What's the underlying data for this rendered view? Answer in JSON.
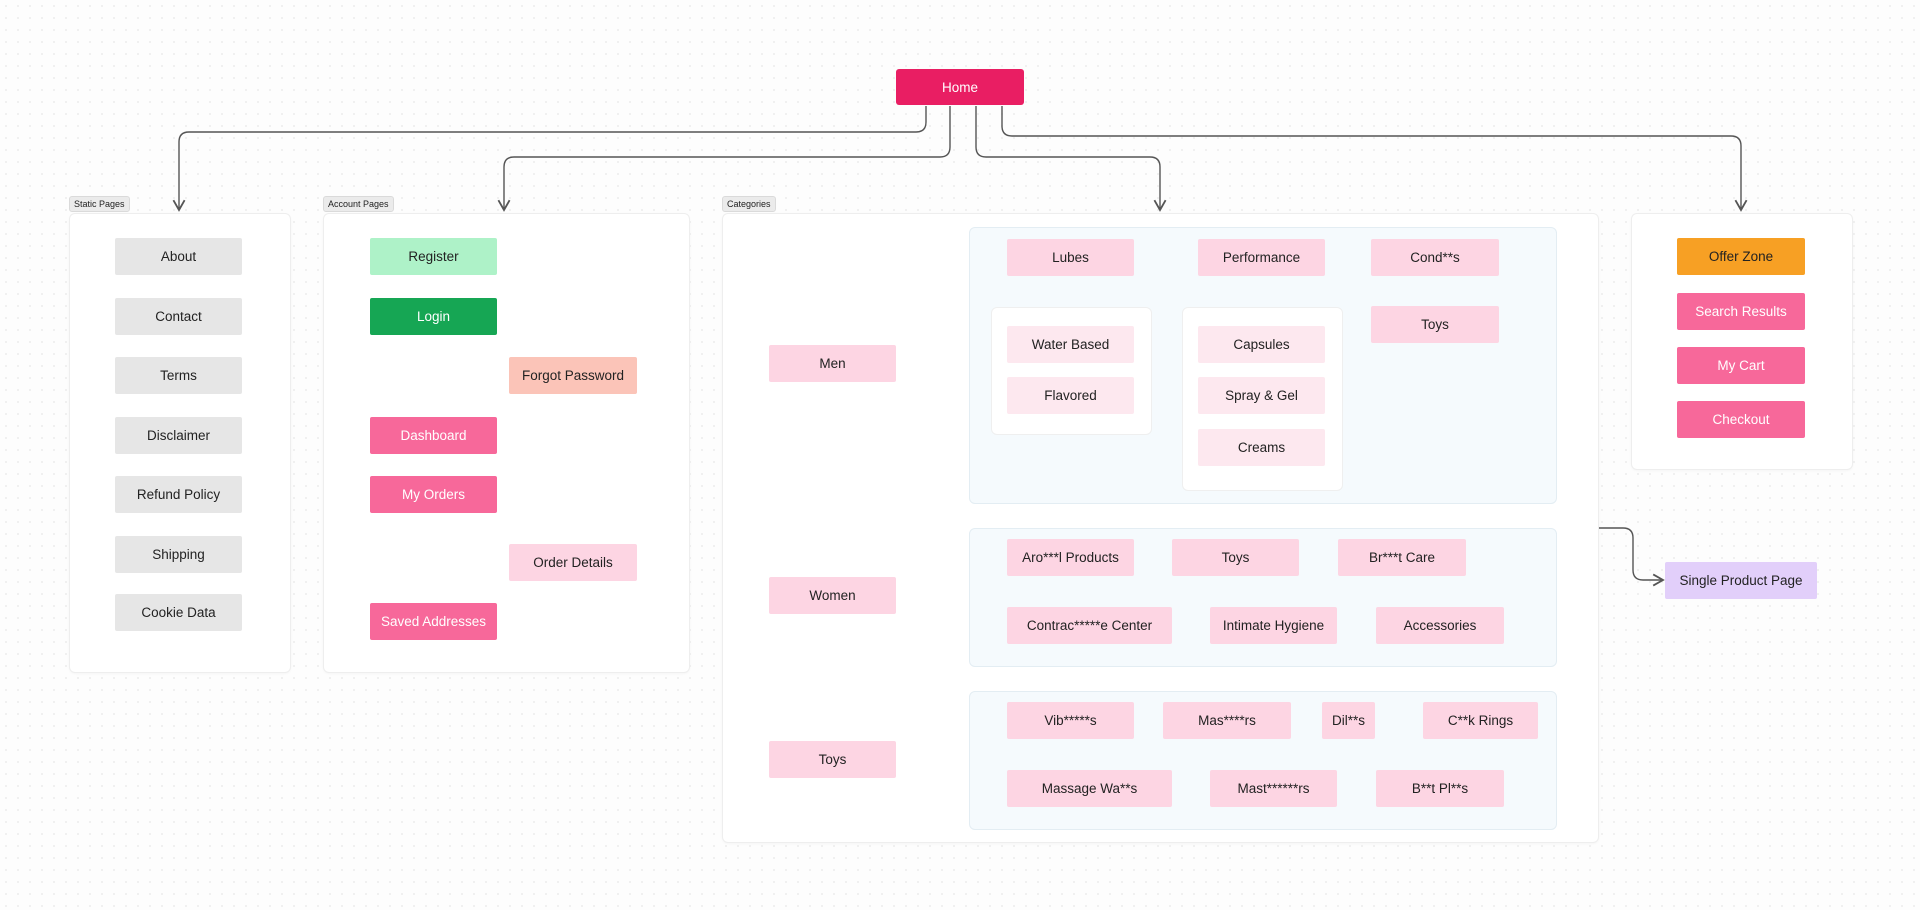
{
  "colors": {
    "home": "#e91e63",
    "register": "#aef2c8",
    "login": "#16a654",
    "forgot": "#fbc4b8",
    "account_pink": "#f7689a",
    "category_pink": "#fdd5e3",
    "offer": "#f7a024",
    "single_product": "#e2cffa",
    "grey": "#e6e6e6"
  },
  "home": {
    "label": "Home"
  },
  "static_pages": {
    "title": "Static Pages",
    "items": [
      "About",
      "Contact",
      "Terms",
      "Disclaimer",
      "Refund Policy",
      "Shipping",
      "Cookie Data"
    ]
  },
  "account_pages": {
    "title": "Account Pages",
    "register": "Register",
    "login": "Login",
    "forgot_password": "Forgot Password",
    "dashboard": "Dashboard",
    "my_orders": "My Orders",
    "order_details": "Order Details",
    "saved_addresses": "Saved Addresses"
  },
  "categories": {
    "title": "Categories",
    "men": {
      "label": "Men",
      "lubes": "Lubes",
      "lubes_children": [
        "Water Based",
        "Flavored"
      ],
      "performance": "Performance",
      "performance_children": [
        "Capsules",
        "Spray & Gel",
        "Creams"
      ],
      "condoms": "Cond**s",
      "toys": "Toys"
    },
    "women": {
      "label": "Women",
      "items": [
        "Aro***l Products",
        "Toys",
        "Br***t Care",
        "Contrac*****e Center",
        "Intimate Hygiene",
        "Accessories"
      ]
    },
    "toys": {
      "label": "Toys",
      "items": [
        "Vib*****s",
        "Mas****rs",
        "Dil**s",
        "C**k Rings",
        "Massage Wa**s",
        "Mast******rs",
        "B**t Pl**s"
      ]
    }
  },
  "other_pages": {
    "items": [
      "Offer Zone",
      "Search Results",
      "My Cart",
      "Checkout"
    ]
  },
  "single_product": {
    "label": "Single Product Page"
  }
}
